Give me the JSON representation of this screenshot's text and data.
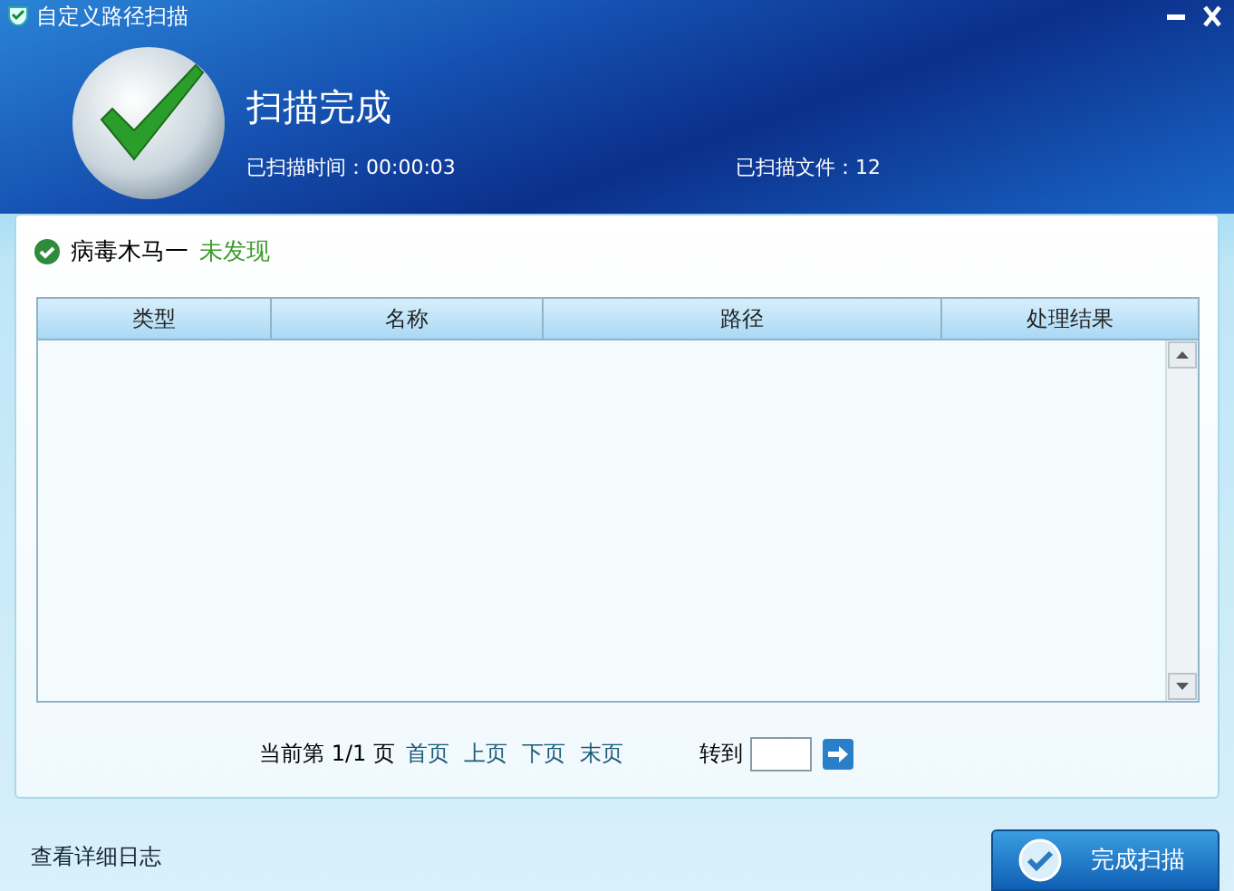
{
  "window": {
    "title": "自定义路径扫描"
  },
  "header": {
    "title": "扫描完成",
    "elapsed": "已扫描时间：00:00:03",
    "files": "已扫描文件：12"
  },
  "result": {
    "label": "病毒木马一",
    "status": "未发现"
  },
  "table": {
    "columns": [
      "类型",
      "名称",
      "路径",
      "处理结果"
    ]
  },
  "pager": {
    "info": "当前第 1/1 页",
    "links": [
      "首页",
      "上页",
      "下页",
      "末页"
    ],
    "goto_label": "转到"
  },
  "footer": {
    "log_link": "查看详细日志",
    "finish_button": "完成扫描"
  }
}
